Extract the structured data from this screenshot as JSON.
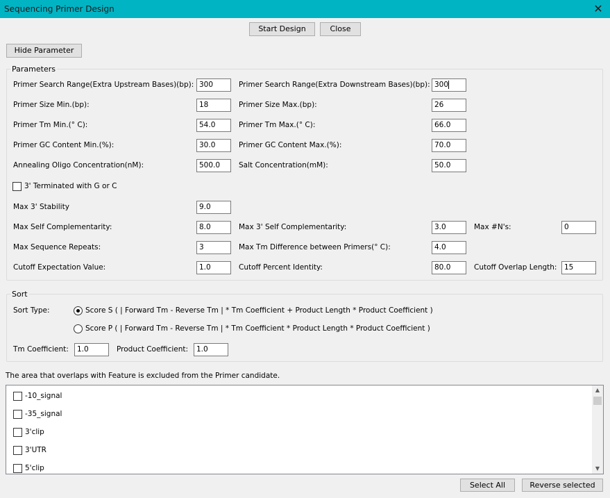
{
  "window": {
    "title": "Sequencing Primer Design",
    "close_glyph": "✕"
  },
  "top_buttons": {
    "start": "Start Design",
    "close": "Close"
  },
  "hide_param_button": "Hide Parameter",
  "parameters": {
    "legend": "Parameters",
    "search_up_label": "Primer Search Range(Extra Upstream Bases)(bp):",
    "search_up_value": "300",
    "search_down_label": "Primer Search Range(Extra Downstream Bases)(bp):",
    "search_down_value": "300",
    "size_min_label": "Primer Size Min.(bp):",
    "size_min_value": "18",
    "size_max_label": "Primer Size Max.(bp):",
    "size_max_value": "26",
    "tm_min_label": "Primer Tm Min.(° C):",
    "tm_min_value": "54.0",
    "tm_max_label": "Primer Tm Max.(° C):",
    "tm_max_value": "66.0",
    "gc_min_label": "Primer GC Content Min.(%):",
    "gc_min_value": "30.0",
    "gc_max_label": "Primer GC Content Max.(%):",
    "gc_max_value": "70.0",
    "oligo_conc_label": "Annealing Oligo Concentration(nM):",
    "oligo_conc_value": "500.0",
    "salt_conc_label": "Salt Concentration(mM):",
    "salt_conc_value": "50.0",
    "terminated_label": "3' Terminated with G or C",
    "terminated_checked": false,
    "max3_stability_label": "Max 3' Stability",
    "max3_stability_value": "9.0",
    "self_comp_label": "Max Self Complementarity:",
    "self_comp_value": "8.0",
    "max3_self_comp_label": "Max 3' Self Complementarity:",
    "max3_self_comp_value": "3.0",
    "max_n_label": "Max #N's:",
    "max_n_value": "0",
    "seq_repeats_label": "Max Sequence Repeats:",
    "seq_repeats_value": "3",
    "tm_diff_label": "Max Tm Difference between Primers(° C):",
    "tm_diff_value": "4.0",
    "cutoff_exp_label": "Cutoff Expectation Value:",
    "cutoff_exp_value": "1.0",
    "cutoff_pct_label": "Cutoff Percent Identity:",
    "cutoff_pct_value": "80.0",
    "cutoff_overlap_label": "Cutoff Overlap Length:",
    "cutoff_overlap_value": "15"
  },
  "sort": {
    "legend": "Sort",
    "type_label": "Sort Type:",
    "score_s": "Score S ( | Forward Tm - Reverse Tm | * Tm Coefficient + Product Length * Product Coefficient )",
    "score_p": "Score P ( | Forward Tm - Reverse Tm | * Tm Coefficient * Product Length * Product Coefficient )",
    "selected": "score_s",
    "tm_coef_label": "Tm Coefficient:",
    "tm_coef_value": "1.0",
    "prod_coef_label": "Product Coefficient:",
    "prod_coef_value": "1.0"
  },
  "feature_note": "The area that overlaps with Feature is excluded from the Primer candidate.",
  "features": [
    {
      "label": "-10_signal",
      "checked": false
    },
    {
      "label": "-35_signal",
      "checked": false
    },
    {
      "label": "3'clip",
      "checked": false
    },
    {
      "label": "3'UTR",
      "checked": false
    },
    {
      "label": "5'clip",
      "checked": false
    }
  ],
  "bottom_buttons": {
    "select_all": "Select All",
    "reverse": "Reverse selected"
  }
}
